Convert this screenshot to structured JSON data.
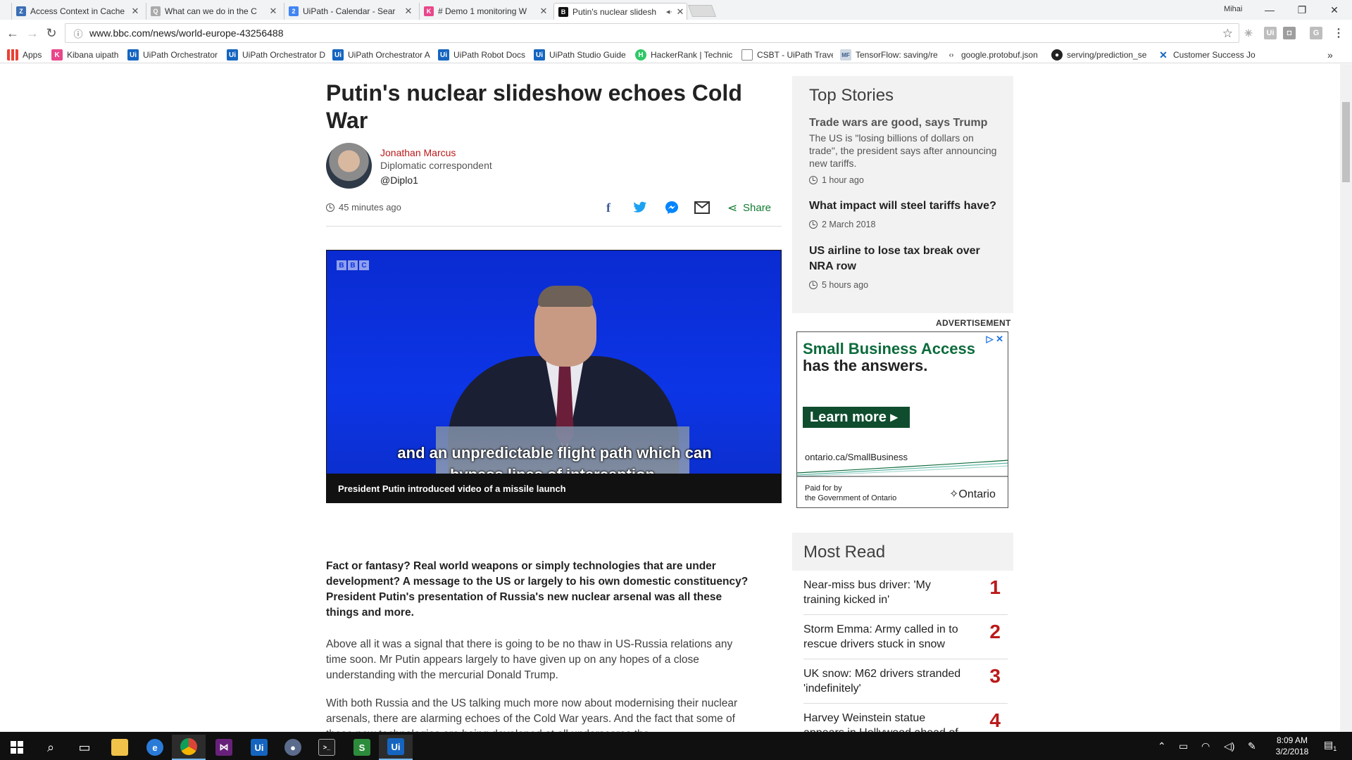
{
  "browser": {
    "tabs": [
      {
        "label": "Access Context in Cache",
        "icon": "uipath-forum-icon",
        "color": "#3b6fb6"
      },
      {
        "label": "What can we do in the C",
        "icon": "forum-icon",
        "color": "#777777"
      },
      {
        "label": "UiPath - Calendar - Sear",
        "icon": "calendar-icon",
        "color": "#4285f4"
      },
      {
        "label": "# Demo 1 monitoring W",
        "icon": "kibana-icon",
        "color": "#e8478b"
      },
      {
        "label": "Putin's nuclear slidesh",
        "icon": "bbc-icon",
        "color": "#111111",
        "active": true,
        "audio": "◂·"
      }
    ],
    "user": "Mihai",
    "url": "www.bbc.com/news/world-europe-43256488",
    "bookmarks": [
      {
        "label": "Apps",
        "icon": "apps-grid-icon"
      },
      {
        "label": "Kibana uipath",
        "icon": "kibana-icon"
      },
      {
        "label": "UiPath Orchestrator",
        "icon": "uipath-icon"
      },
      {
        "label": "UiPath Orchestrator D",
        "icon": "uipath-icon"
      },
      {
        "label": "UiPath Orchestrator A",
        "icon": "uipath-icon"
      },
      {
        "label": "UiPath Robot Docs",
        "icon": "uipath-icon"
      },
      {
        "label": "UiPath Studio Guide",
        "icon": "uipath-icon"
      },
      {
        "label": "HackerRank | Technic",
        "icon": "hackerrank-icon"
      },
      {
        "label": "CSBT - UiPath Travel",
        "icon": "page-icon"
      },
      {
        "label": "TensorFlow: saving/re",
        "icon": "mf-icon"
      },
      {
        "label": "google.protobuf.json",
        "icon": "code-icon"
      },
      {
        "label": "serving/prediction_se",
        "icon": "github-icon"
      },
      {
        "label": "Customer Success Jo",
        "icon": "confluence-icon"
      }
    ],
    "more_bookmarks": "»"
  },
  "article": {
    "headline": "Putin's nuclear slideshow echoes Cold War",
    "author": {
      "name": "Jonathan Marcus",
      "role": "Diplomatic correspondent",
      "twitter": "@Diplo1"
    },
    "time": "45 minutes ago",
    "share_label": "Share",
    "video": {
      "logo": [
        "B",
        "B",
        "C"
      ],
      "subtitle_line1": "and an unpredictable flight path which can",
      "subtitle_line2": "bypass lines of interception,",
      "caption": "President Putin introduced video of a missile launch"
    },
    "intro": "Fact or fantasy? Real world weapons or simply technologies that are under development? A message to the US or largely to his own domestic constituency? President Putin's presentation of Russia's new nuclear arsenal was all these things and more.",
    "para1": "Above all it was a signal that there is going to be no thaw in US-Russia relations any time soon. Mr Putin appears largely to have given up on any hopes of a close understanding with the mercurial Donald Trump.",
    "para2": "With both Russia and the US talking much more now about modernising their nuclear arsenals, there are alarming echoes of the Cold War years. And the fact that some of these new technologies are being developed at all underscores the"
  },
  "top_stories": {
    "title": "Top Stories",
    "items": [
      {
        "headline": "Trade wars are good, says Trump",
        "summary": "The US is \"losing billions of dollars on trade\", the president says after announcing new tariffs.",
        "time": "1 hour ago"
      },
      {
        "headline": "What impact will steel tariffs have?",
        "time": "2 March 2018"
      },
      {
        "headline": "US airline to lose tax break over NRA row",
        "time": "5 hours ago"
      }
    ]
  },
  "advert": {
    "label": "ADVERTISEMENT",
    "line1": "Small Business Access",
    "line2": "has the answers.",
    "button": "Learn more ▸",
    "url": "ontario.ca/SmallBusiness",
    "paid1": "Paid for by",
    "paid2": "the Government of Ontario",
    "brand": "Ontario",
    "close": "▷ ✕"
  },
  "most_read": {
    "title": "Most Read",
    "items": [
      {
        "text": "Near-miss bus driver: 'My training kicked in'",
        "rank": "1"
      },
      {
        "text": "Storm Emma: Army called in to rescue drivers stuck in snow",
        "rank": "2"
      },
      {
        "text": "UK snow: M62 drivers stranded 'indefinitely'",
        "rank": "3"
      },
      {
        "text": "Harvey Weinstein statue appears in Hollywood ahead of",
        "rank": "4"
      }
    ]
  },
  "taskbar": {
    "time": "8:09 AM",
    "date": "3/2/2018",
    "notification_count": "1"
  },
  "colors": {
    "bbc_red": "#bb1919",
    "share_green": "#117b30",
    "facebook": "#3b5998",
    "twitter": "#1da1f2",
    "messenger": "#0084ff"
  }
}
